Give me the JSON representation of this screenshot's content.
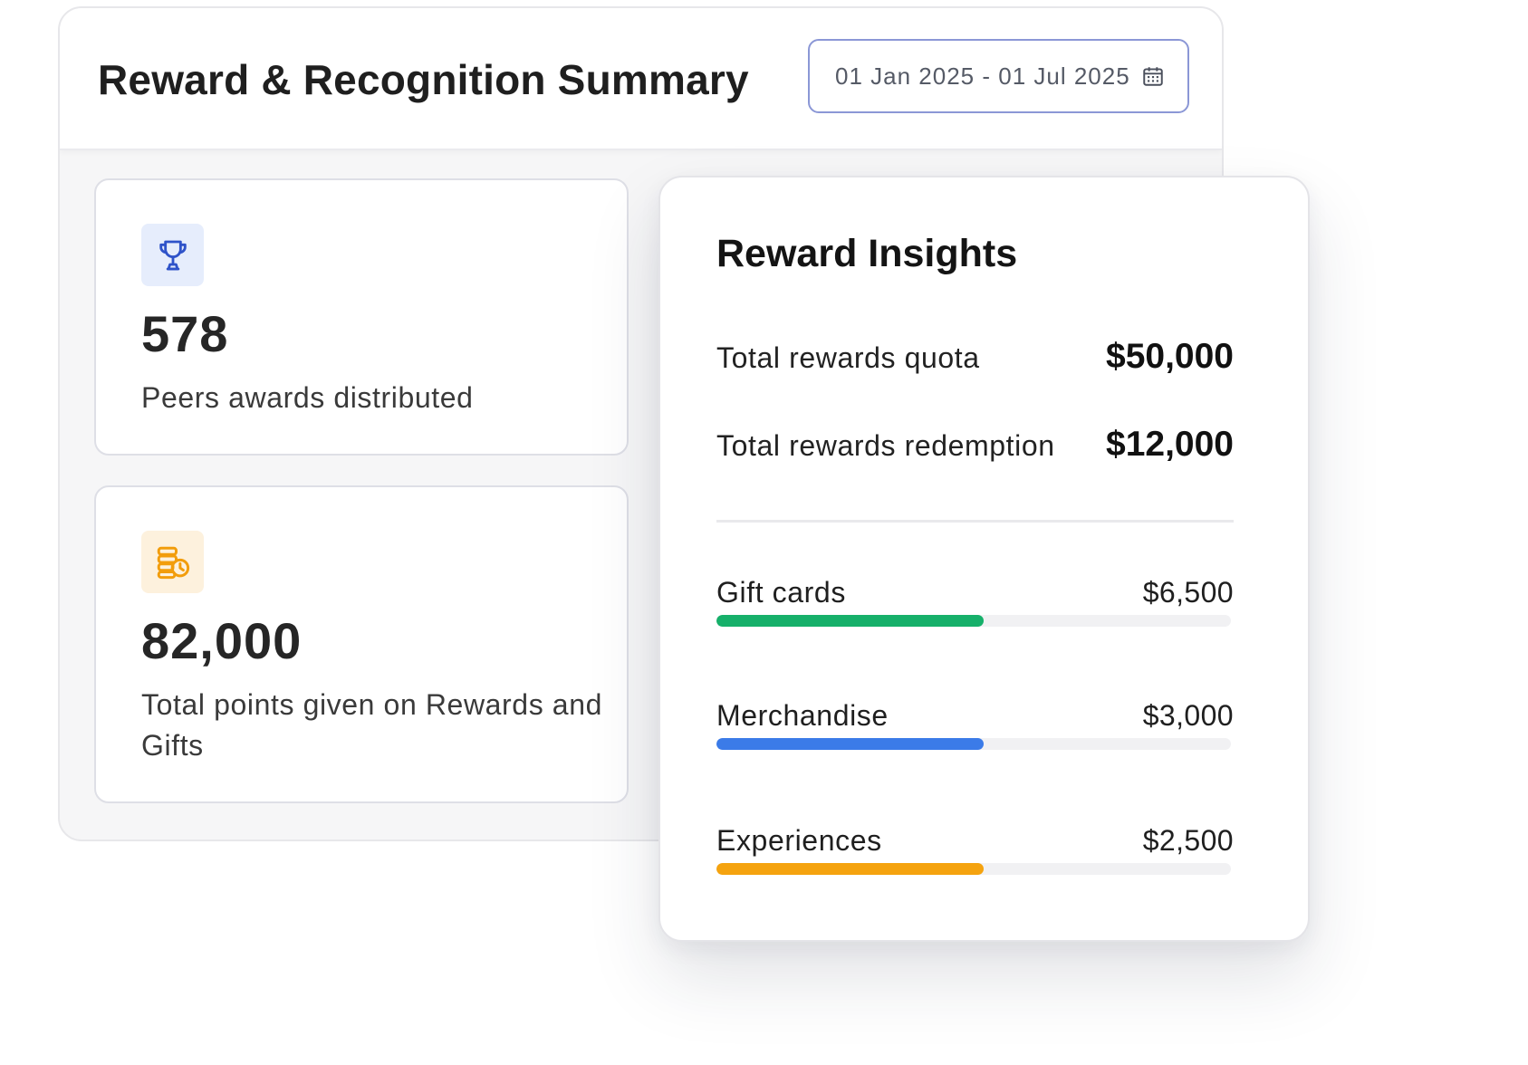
{
  "summary": {
    "title": "Reward & Recognition Summary",
    "date_range": "01 Jan 2025 - 01 Jul 2025",
    "date_icon": "calendar-icon"
  },
  "stats": [
    {
      "icon": "trophy-icon",
      "icon_color": "#2f53c9",
      "icon_bg": "#e6edfc",
      "value": "578",
      "label": "Peers awards distributed"
    },
    {
      "icon": "coins-icon",
      "icon_color": "#f29d0c",
      "icon_bg": "#fdf1dd",
      "value": "82,000",
      "label": "Total points given on Rewards and Gifts"
    }
  ],
  "insights": {
    "title": "Reward Insights",
    "metrics": [
      {
        "label": "Total rewards quota",
        "value": "$50,000"
      },
      {
        "label": "Total rewards redemption",
        "value": "$12,000"
      }
    ],
    "categories": [
      {
        "label": "Gift cards",
        "amount": "$6,500",
        "progress": 0.52,
        "color": "#16b06a"
      },
      {
        "label": "Merchandise",
        "amount": "$3,000",
        "progress": 0.52,
        "color": "#3b7be8"
      },
      {
        "label": "Experiences",
        "amount": "$2,500",
        "progress": 0.52,
        "color": "#f5a30f"
      }
    ]
  }
}
